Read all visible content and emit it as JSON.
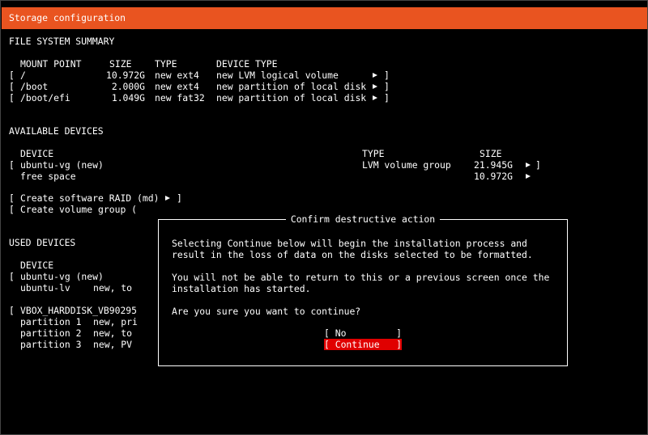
{
  "title": "Storage configuration",
  "fs_summary": {
    "heading": "FILE SYSTEM SUMMARY",
    "headers": {
      "mount_point": "MOUNT POINT",
      "size": "SIZE",
      "type": "TYPE",
      "device_type": "DEVICE TYPE"
    },
    "rows": [
      {
        "mount": "/",
        "size": "10.972G",
        "type": "new ext4",
        "device_type": "new LVM logical volume"
      },
      {
        "mount": "/boot",
        "size": "2.000G",
        "type": "new ext4",
        "device_type": "new partition of local disk"
      },
      {
        "mount": "/boot/efi",
        "size": "1.049G",
        "type": "new fat32",
        "device_type": "new partition of local disk"
      }
    ]
  },
  "available": {
    "heading": "AVAILABLE DEVICES",
    "headers": {
      "device": "DEVICE",
      "type": "TYPE",
      "size": "SIZE"
    },
    "vg_name": "ubuntu-vg (new)",
    "vg_type": "LVM volume group",
    "vg_size": "21.945G",
    "free_label": "free space",
    "free_size": "10.972G",
    "create_raid": "Create software RAID (md)",
    "create_vg": "Create volume group ("
  },
  "used": {
    "heading": "USED DEVICES",
    "header_device": "DEVICE",
    "vg_name": "ubuntu-vg (new)",
    "lv_name": "ubuntu-lv",
    "lv_info": "new, to",
    "disk_name": "VBOX_HARDDISK_VB90295",
    "partitions": [
      {
        "name": "partition 1",
        "info": "new, pri"
      },
      {
        "name": "partition 2",
        "info": "new, to"
      },
      {
        "name": "partition 3",
        "info": "new, PV"
      }
    ]
  },
  "dialog": {
    "title": "Confirm destructive action",
    "line1": "Selecting Continue below will begin the installation process and",
    "line2": "result in the loss of data on the disks selected to be formatted.",
    "line3": "You will not be able to return to this or a previous screen once the",
    "line4": "installation has started.",
    "question": "Are you sure you want to continue?",
    "no_label": "[ No         ]",
    "continue_label": "[ Continue   ]"
  },
  "colors": {
    "accent": "#e95420",
    "focus": "#e00000",
    "background": "#000000",
    "text": "#ffffff"
  },
  "icons": {
    "row_action": "triangle-right-icon"
  }
}
